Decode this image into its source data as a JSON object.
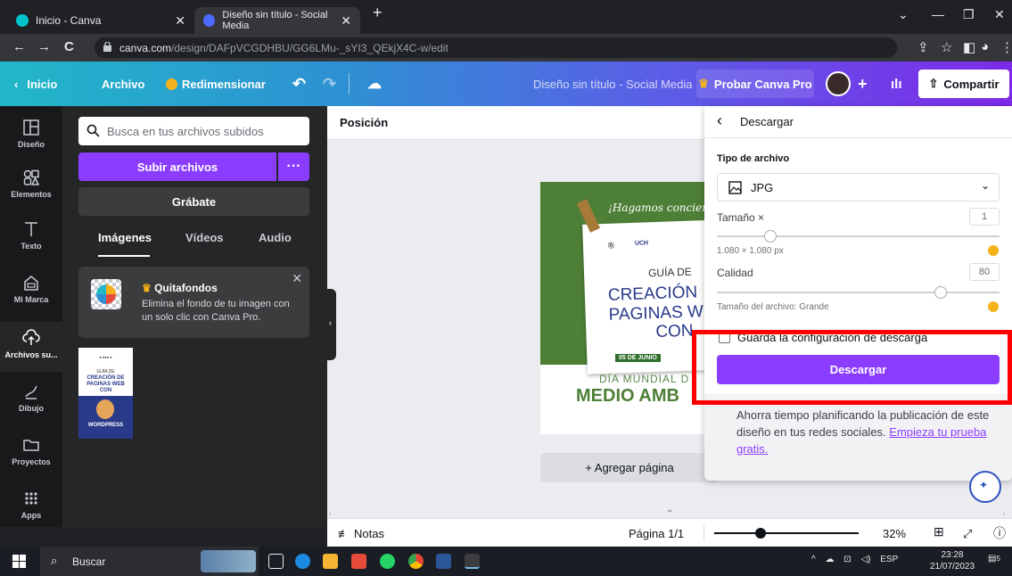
{
  "browser": {
    "tabs": [
      {
        "title": "Inicio - Canva",
        "active": false
      },
      {
        "title": "Diseño sin título - Social Media",
        "active": true
      }
    ],
    "new_tab": "+",
    "url_host": "canva.com",
    "url_path": "/design/DAFpVCGDHBU/GG6LMu-_sYI3_QEkjX4C-w/edit"
  },
  "header": {
    "home": "Inicio",
    "file": "Archivo",
    "resize": "Redimensionar",
    "doc_title": "Diseño sin título - Social Media",
    "try_pro": "Probar Canva Pro",
    "share": "Compartir"
  },
  "rail": {
    "items": [
      {
        "label": "Diseño",
        "icon": "layout-icon"
      },
      {
        "label": "Elementos",
        "icon": "shapes-icon"
      },
      {
        "label": "Texto",
        "icon": "text-icon"
      },
      {
        "label": "Mi Marca",
        "icon": "brand-icon"
      },
      {
        "label": "Archivos su...",
        "icon": "upload-icon"
      },
      {
        "label": "Dibujo",
        "icon": "draw-icon"
      },
      {
        "label": "Proyectos",
        "icon": "folder-icon"
      },
      {
        "label": "Apps",
        "icon": "apps-icon"
      }
    ]
  },
  "panel": {
    "search_placeholder": "Busca en tus archivos subidos",
    "upload": "Subir archivos",
    "upload_more": "···",
    "record": "Grábate",
    "tabs": [
      "Imágenes",
      "Vídeos",
      "Audio"
    ],
    "promo_title": "Quitafondos",
    "promo_body": "Elimina el fondo de tu imagen con un solo clic con Canva Pro."
  },
  "thumbnail": {
    "line1": "GUÍA DE",
    "line2": "CREACIÓN DE",
    "line3": "PAGINAS WEB",
    "line4": "CON",
    "footer": "WORDPRESS"
  },
  "canvas": {
    "position_label": "Posición",
    "design": {
      "script_text": "¡Hagamos concienc",
      "logo": "UCH",
      "line1": "GUÍA DE",
      "line2": "CREACIÓN",
      "line3": "PAGINAS W",
      "line4": "CON",
      "date_tag": "05 DE JUNIO",
      "sub": "DÍA MUNDIAL D",
      "headline": "MEDIO AMB"
    },
    "add_page": "+ Agregar página"
  },
  "bottom": {
    "notes": "Notas",
    "page": "Página 1/1",
    "zoom": "32%",
    "zoom_fraction": 0.32
  },
  "download": {
    "title": "Descargar",
    "file_type_label": "Tipo de archivo",
    "file_type": "JPG",
    "size_label": "Tamaño ×",
    "size_value": "1",
    "size_dims": "1.080 × 1.080 px",
    "quality_label": "Calidad",
    "quality_value": "80",
    "file_size": "Tamaño del archivo: Grande",
    "save_settings": "Guarda la configuración de descarga",
    "button": "Descargar",
    "footer_text": "Ahorra tiempo planificando la publicación de este diseño en tus redes sociales.",
    "footer_link": "Empieza tu prueba gratis."
  },
  "taskbar": {
    "search": "Buscar",
    "lang": "ESP",
    "time": "23:28",
    "date": "21/07/2023",
    "notif_count": "5"
  },
  "colors": {
    "canva_purple": "#8b3dff",
    "highlight_red": "#ff0000"
  }
}
